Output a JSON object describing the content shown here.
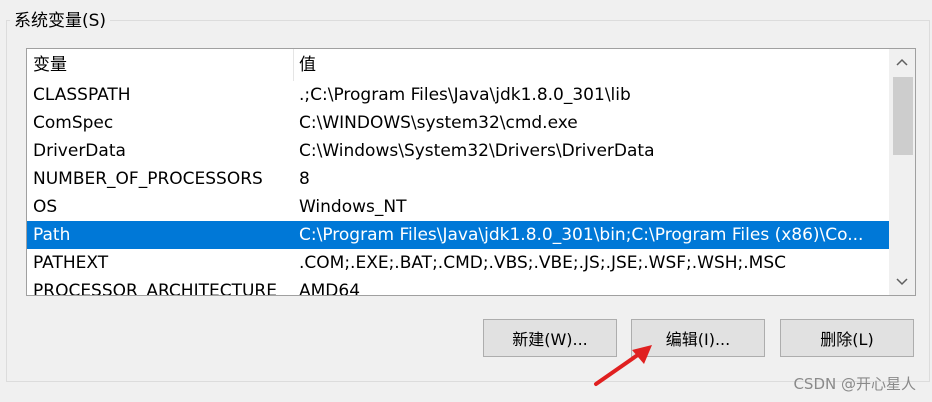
{
  "group": {
    "title": "系统变量(S)"
  },
  "table": {
    "headers": {
      "name": "变量",
      "value": "值"
    },
    "rows": [
      {
        "name": "CLASSPATH",
        "value": ".;C:\\Program Files\\Java\\jdk1.8.0_301\\lib"
      },
      {
        "name": "ComSpec",
        "value": "C:\\WINDOWS\\system32\\cmd.exe"
      },
      {
        "name": "DriverData",
        "value": "C:\\Windows\\System32\\Drivers\\DriverData"
      },
      {
        "name": "NUMBER_OF_PROCESSORS",
        "value": "8"
      },
      {
        "name": "OS",
        "value": "Windows_NT"
      },
      {
        "name": "Path",
        "value": "C:\\Program Files\\Java\\jdk1.8.0_301\\bin;C:\\Program Files (x86)\\Co...",
        "selected": true
      },
      {
        "name": "PATHEXT",
        "value": ".COM;.EXE;.BAT;.CMD;.VBS;.VBE;.JS;.JSE;.WSF;.WSH;.MSC"
      },
      {
        "name": "PROCESSOR_ARCHITECTURE",
        "value": "AMD64"
      }
    ]
  },
  "scrollbar": {
    "up_icon": "chevron-up-icon",
    "down_icon": "chevron-down-icon"
  },
  "buttons": {
    "new": "新建(W)...",
    "edit": "编辑(I)...",
    "delete": "删除(L)"
  },
  "annotation": {
    "arrow_color": "#e02020"
  },
  "watermark": "CSDN @开心星人",
  "colors": {
    "selection": "#0078d7",
    "window_bg": "#f0f0f0"
  }
}
